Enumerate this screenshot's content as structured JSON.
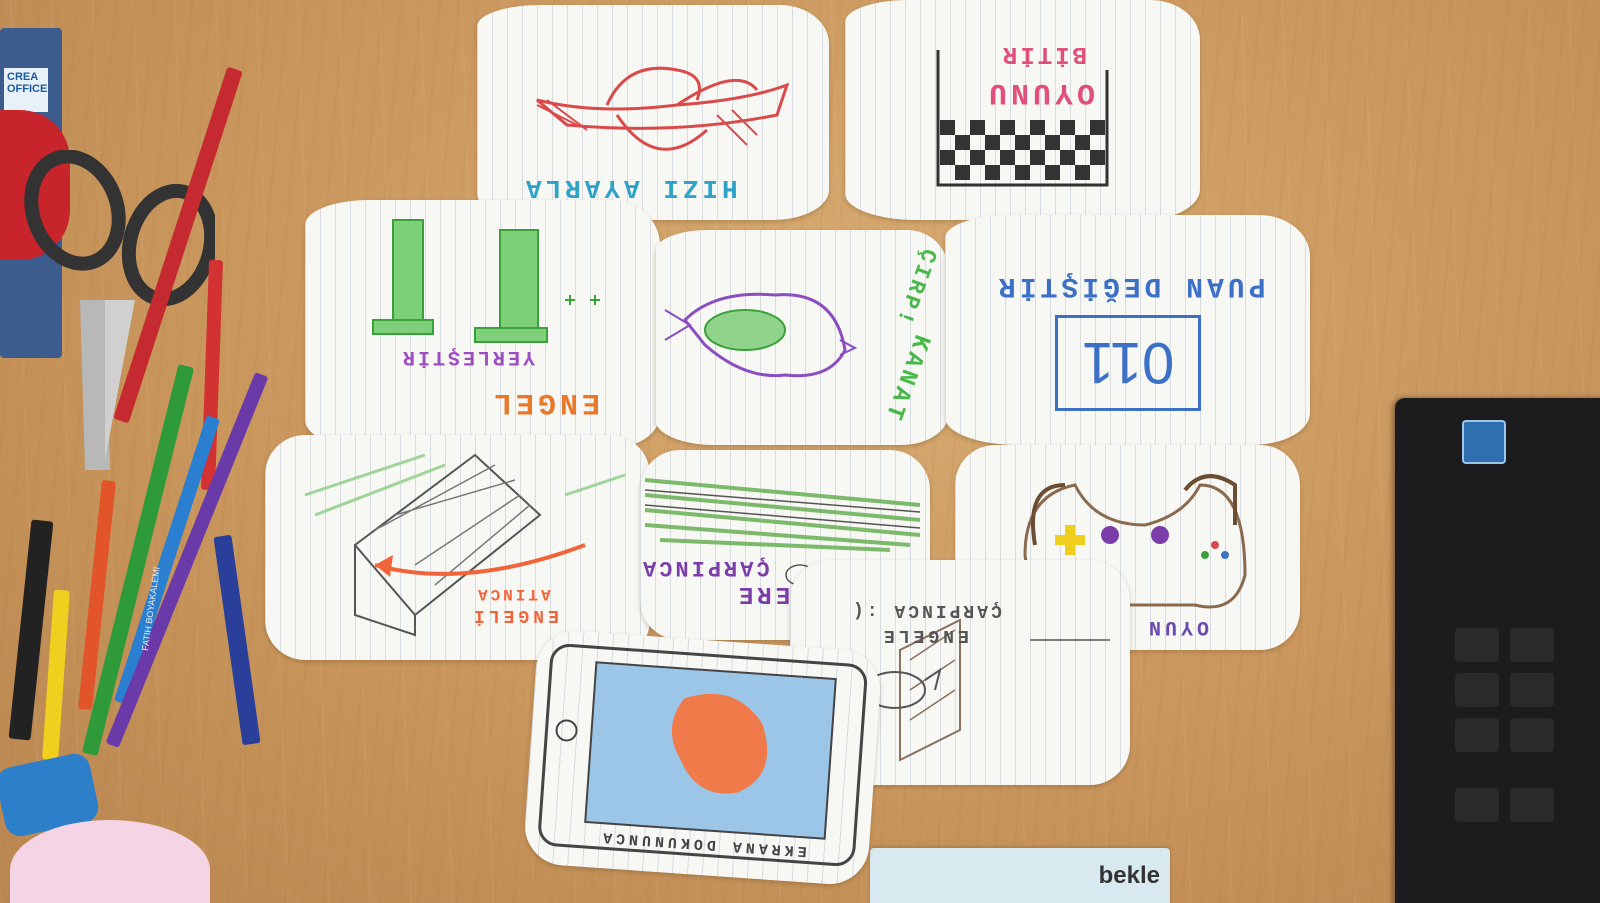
{
  "scene": {
    "package_label": "CREA OFFICE",
    "sticky_tape_label": "bekle",
    "pencil_brand": "FATIH BOYAKALEMI",
    "colors": {
      "desk": "#c99a62",
      "paper": "#f7f7f4",
      "laptop": "#1c1c1e"
    }
  },
  "cards": [
    {
      "id": "hiz",
      "caption": "HIZI AYARLA",
      "sketch": "airplane",
      "ink": "#2ea3c7",
      "sketch_color": "#d94a4a"
    },
    {
      "id": "oyunu-bitir",
      "caption": "OYUNU",
      "caption2": "BİTİR",
      "sketch": "checker-box",
      "ink": "#e0507a"
    },
    {
      "id": "engel-yerlestir",
      "caption": "ENGEL",
      "caption2": "YERLEŞTİR",
      "sketch": "pipes",
      "ink": "#e67a2a",
      "ink2": "#9d4fc2"
    },
    {
      "id": "kanat-cirp",
      "caption": "KANAT",
      "caption2": "ÇIRP!",
      "sketch": "bird",
      "ink": "#49b84a"
    },
    {
      "id": "puan-degistir",
      "caption": "PUAN DEĞİŞTİR",
      "score": "011",
      "ink": "#3c6fc6"
    },
    {
      "id": "engeli-atinca",
      "caption": "ENGELİ",
      "caption2": "ATINCA",
      "sketch": "brick-wall",
      "ink": "#f0643a"
    },
    {
      "id": "yere-carpinca",
      "caption": "YERE",
      "caption2": "ÇARPINCA",
      "sketch": "grass",
      "ink": "#7b3ea8"
    },
    {
      "id": "oyun",
      "caption": "OYUN",
      "sketch": "gamepad",
      "ink": "#6a4ab0"
    },
    {
      "id": "engele-carpinca",
      "caption": "ENGELE",
      "caption2": "ÇARPINCA :(",
      "sketch": "bird-crash",
      "ink": "#555555"
    },
    {
      "id": "ekrana-dokununca",
      "caption": "EKRANA DOKUNUNCA",
      "sketch": "phone",
      "ink": "#444444"
    }
  ]
}
